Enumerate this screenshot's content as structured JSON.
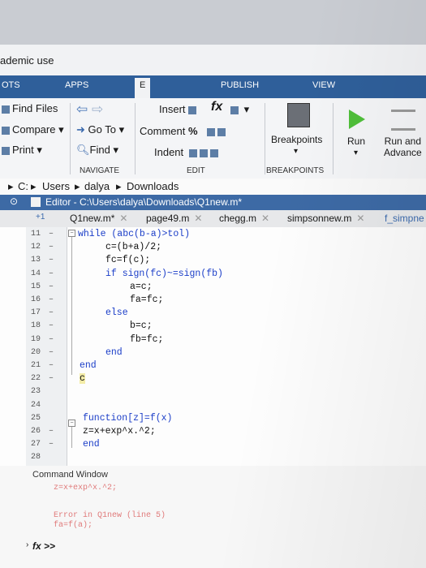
{
  "window": {
    "title_fragment": "ademic use"
  },
  "toolstrip_tabs": [
    "OTS",
    "APPS",
    "E",
    "PUBLISH",
    "VIEW"
  ],
  "ribbon": {
    "file": {
      "find_files": "Find Files",
      "compare": "Compare",
      "print": "Print"
    },
    "navigate": {
      "goto": "Go To",
      "find": "Find",
      "label": "NAVIGATE"
    },
    "edit": {
      "insert": "Insert",
      "comment": "Comment",
      "indent": "Indent",
      "label": "EDIT",
      "fx": "fx"
    },
    "breakpoints": {
      "button": "Breakpoints",
      "label": "BREAKPOINTS"
    },
    "run": {
      "run": "Run",
      "run_advance_1": "Run and",
      "run_advance_2": "Advance"
    }
  },
  "breadcrumb": [
    "C:",
    "Users",
    "dalya",
    "Downloads"
  ],
  "editor": {
    "title": "Editor - C:\\Users\\dalya\\Downloads\\Q1new.m*",
    "plus_one": "+1",
    "tabs": [
      "Q1new.m*",
      "page49.m",
      "chegg.m",
      "simpsonnew.m",
      "f_simpne"
    ]
  },
  "code_lines": [
    {
      "n": "11",
      "mark": "–",
      "text": "while (abc(b-a)>tol)"
    },
    {
      "n": "12",
      "mark": "–",
      "text": "c=(b+a)/2;"
    },
    {
      "n": "13",
      "mark": "–",
      "text": "fc=f(c);"
    },
    {
      "n": "14",
      "mark": "–",
      "text": "if sign(fc)~=sign(fb)"
    },
    {
      "n": "15",
      "mark": "–",
      "text": "a=c;"
    },
    {
      "n": "16",
      "mark": "–",
      "text": "fa=fc;"
    },
    {
      "n": "17",
      "mark": "–",
      "text": "else"
    },
    {
      "n": "18",
      "mark": "–",
      "text": "b=c;"
    },
    {
      "n": "19",
      "mark": "–",
      "text": "fb=fc;"
    },
    {
      "n": "20",
      "mark": "–",
      "text": "end"
    },
    {
      "n": "21",
      "mark": "–",
      "text": "end"
    },
    {
      "n": "22",
      "mark": "–",
      "text": "c"
    },
    {
      "n": "23",
      "mark": "",
      "text": ""
    },
    {
      "n": "24",
      "mark": "",
      "text": ""
    },
    {
      "n": "25",
      "mark": "",
      "text": "function[z]=f(x)"
    },
    {
      "n": "26",
      "mark": "–",
      "text": "z=x+exp^x.^2;"
    },
    {
      "n": "27",
      "mark": "–",
      "text": "end"
    },
    {
      "n": "28",
      "mark": "",
      "text": ""
    }
  ],
  "command_window": {
    "title": "Command Window",
    "lines": [
      "z=x+exp^x.^2;",
      "",
      "Error in Q1new (line 5)",
      "fa=f(a);"
    ],
    "prompt": "fx >>"
  }
}
